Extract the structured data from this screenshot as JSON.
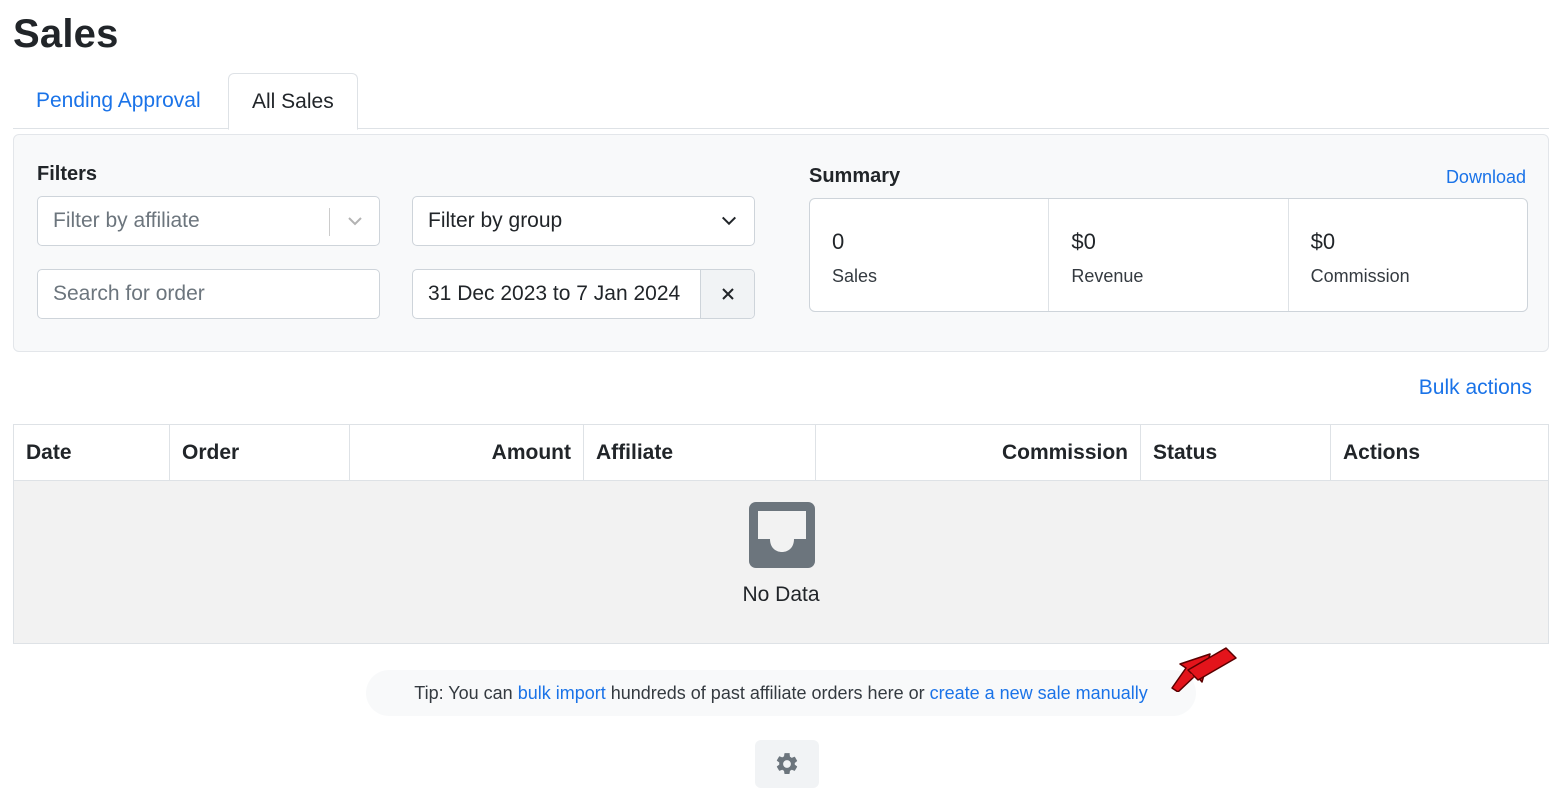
{
  "page": {
    "title": "Sales"
  },
  "tabs": [
    {
      "label": "Pending Approval",
      "active": false
    },
    {
      "label": "All Sales",
      "active": true
    }
  ],
  "filters": {
    "label": "Filters",
    "affiliate_placeholder": "Filter by affiliate",
    "group_value": "Filter by group",
    "search_placeholder": "Search for order",
    "date_range": "31 Dec 2023 to 7 Jan 2024"
  },
  "summary": {
    "label": "Summary",
    "download_label": "Download",
    "stats": [
      {
        "value": "0",
        "label": "Sales"
      },
      {
        "value": "$0",
        "label": "Revenue"
      },
      {
        "value": "$0",
        "label": "Commission"
      }
    ]
  },
  "table": {
    "bulk_actions_label": "Bulk actions",
    "columns": [
      "Date",
      "Order",
      "Amount",
      "Affiliate",
      "Commission",
      "Status",
      "Actions"
    ],
    "rows": [],
    "empty_text": "No Data"
  },
  "tip": {
    "prefix": "Tip: You can ",
    "link1": "bulk import",
    "middle": " hundreds of past affiliate orders here or ",
    "link2": "create a new sale manually"
  },
  "icons": {
    "empty": "inbox-icon",
    "settings": "gear-icon",
    "pointer": "red-arrow-icon",
    "clear": "close-icon"
  },
  "colors": {
    "link": "#1a73e8",
    "arrow": "#e3141b",
    "empty_icon": "#6c757d"
  }
}
